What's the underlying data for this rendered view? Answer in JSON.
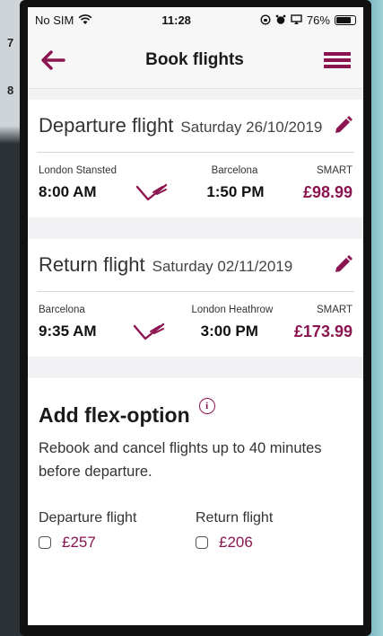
{
  "status": {
    "carrier": "No SIM",
    "time": "11:28",
    "battery": "76%"
  },
  "nav": {
    "title": "Book flights"
  },
  "departure": {
    "heading": "Departure flight",
    "date": "Saturday 26/10/2019",
    "from": "London Stansted",
    "to": "Barcelona",
    "fare": "SMART",
    "dep_time": "8:00 AM",
    "arr_time": "1:50 PM",
    "price": "£98.99"
  },
  "return": {
    "heading": "Return flight",
    "date": "Saturday 02/11/2019",
    "from": "Barcelona",
    "to": "London Heathrow",
    "fare": "SMART",
    "dep_time": "9:35 AM",
    "arr_time": "3:00 PM",
    "price": "£173.99"
  },
  "flex": {
    "title": "Add flex-option",
    "description": "Rebook and cancel flights up to 40 minutes before departure.",
    "departure_label": "Departure flight",
    "departure_price": "£257",
    "return_label": "Return flight",
    "return_price": "£206"
  },
  "background": {
    "num1": "7",
    "num2": "8"
  },
  "colors": {
    "accent": "#8b1550"
  }
}
